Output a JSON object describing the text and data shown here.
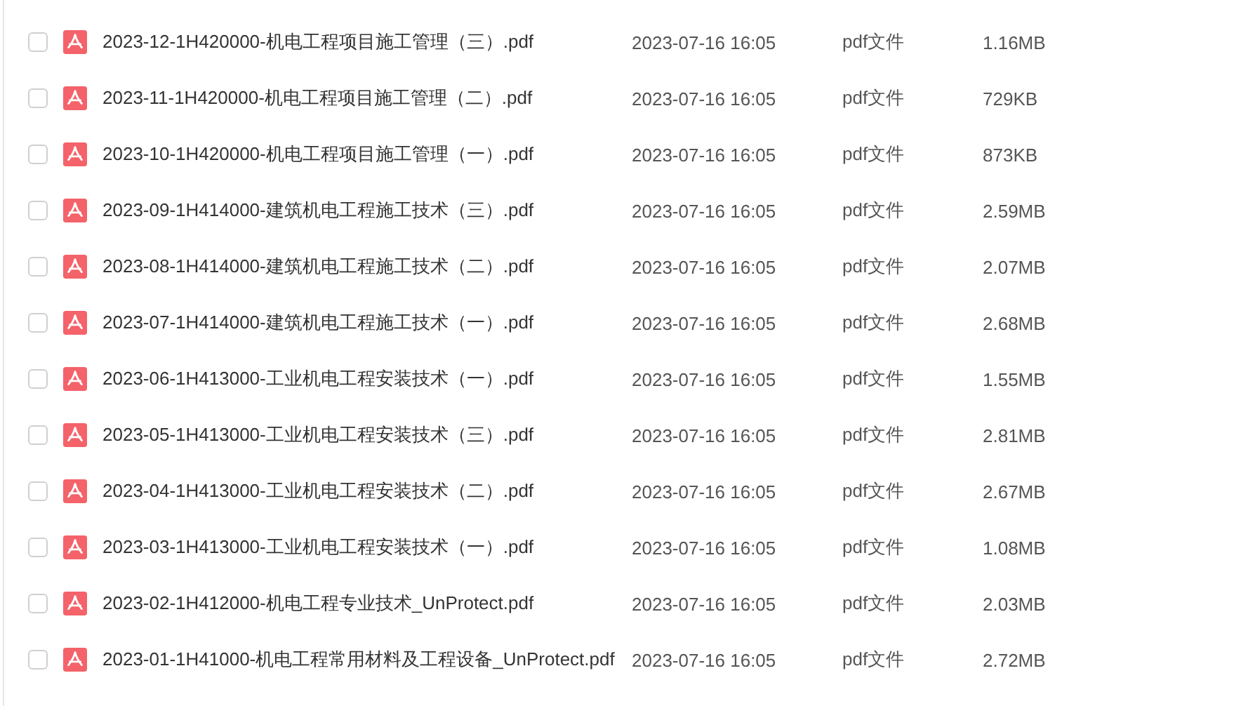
{
  "files": [
    {
      "name": "2023-12-1H420000-机电工程项目施工管理（三）.pdf",
      "modified": "2023-07-16 16:05",
      "type": "pdf文件",
      "size": "1.16MB",
      "checked": false
    },
    {
      "name": "2023-11-1H420000-机电工程项目施工管理（二）.pdf",
      "modified": "2023-07-16 16:05",
      "type": "pdf文件",
      "size": "729KB",
      "checked": false
    },
    {
      "name": "2023-10-1H420000-机电工程项目施工管理（一）.pdf",
      "modified": "2023-07-16 16:05",
      "type": "pdf文件",
      "size": "873KB",
      "checked": false
    },
    {
      "name": "2023-09-1H414000-建筑机电工程施工技术（三）.pdf",
      "modified": "2023-07-16 16:05",
      "type": "pdf文件",
      "size": "2.59MB",
      "checked": false
    },
    {
      "name": "2023-08-1H414000-建筑机电工程施工技术（二）.pdf",
      "modified": "2023-07-16 16:05",
      "type": "pdf文件",
      "size": "2.07MB",
      "checked": false
    },
    {
      "name": "2023-07-1H414000-建筑机电工程施工技术（一）.pdf",
      "modified": "2023-07-16 16:05",
      "type": "pdf文件",
      "size": "2.68MB",
      "checked": false
    },
    {
      "name": "2023-06-1H413000-工业机电工程安装技术（一）.pdf",
      "modified": "2023-07-16 16:05",
      "type": "pdf文件",
      "size": "1.55MB",
      "checked": false
    },
    {
      "name": "2023-05-1H413000-工业机电工程安装技术（三）.pdf",
      "modified": "2023-07-16 16:05",
      "type": "pdf文件",
      "size": "2.81MB",
      "checked": false
    },
    {
      "name": "2023-04-1H413000-工业机电工程安装技术（二）.pdf",
      "modified": "2023-07-16 16:05",
      "type": "pdf文件",
      "size": "2.67MB",
      "checked": false
    },
    {
      "name": "2023-03-1H413000-工业机电工程安装技术（一）.pdf",
      "modified": "2023-07-16 16:05",
      "type": "pdf文件",
      "size": "1.08MB",
      "checked": false
    },
    {
      "name": "2023-02-1H412000-机电工程专业技术_UnProtect.pdf",
      "modified": "2023-07-16 16:05",
      "type": "pdf文件",
      "size": "2.03MB",
      "checked": false
    },
    {
      "name": "2023-01-1H41000-机电工程常用材料及工程设备_UnProtect.pdf",
      "modified": "2023-07-16 16:05",
      "type": "pdf文件",
      "size": "2.72MB",
      "checked": false
    }
  ]
}
